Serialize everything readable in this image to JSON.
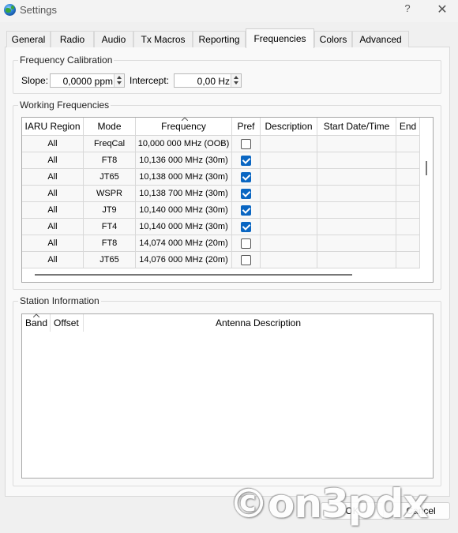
{
  "window": {
    "title": "Settings",
    "help_label": "?",
    "close_label": "✕"
  },
  "tabs": [
    {
      "label": "General"
    },
    {
      "label": "Radio"
    },
    {
      "label": "Audio"
    },
    {
      "label": "Tx Macros"
    },
    {
      "label": "Reporting"
    },
    {
      "label": "Frequencies",
      "active": true
    },
    {
      "label": "Colors"
    },
    {
      "label": "Advanced"
    }
  ],
  "calibration": {
    "title": "Frequency Calibration",
    "slope_label": "Slope:",
    "slope_value": "0,0000 ppm",
    "intercept_label": "Intercept:",
    "intercept_value": "0,00 Hz"
  },
  "working": {
    "title": "Working Frequencies",
    "columns": [
      "IARU Region",
      "Mode",
      "Frequency",
      "Pref",
      "Description",
      "Start Date/Time",
      "End"
    ],
    "rows": [
      {
        "region": "All",
        "mode": "FreqCal",
        "frequency": "10,000 000 MHz (OOB)",
        "pref": false
      },
      {
        "region": "All",
        "mode": "FT8",
        "frequency": "10,136 000 MHz (30m)",
        "pref": true
      },
      {
        "region": "All",
        "mode": "JT65",
        "frequency": "10,138 000 MHz (30m)",
        "pref": true
      },
      {
        "region": "All",
        "mode": "WSPR",
        "frequency": "10,138 700 MHz (30m)",
        "pref": true
      },
      {
        "region": "All",
        "mode": "JT9",
        "frequency": "10,140 000 MHz (30m)",
        "pref": true
      },
      {
        "region": "All",
        "mode": "FT4",
        "frequency": "10,140 000 MHz (30m)",
        "pref": true
      },
      {
        "region": "All",
        "mode": "FT8",
        "frequency": "14,074 000 MHz (20m)",
        "pref": false
      },
      {
        "region": "All",
        "mode": "JT65",
        "frequency": "14,076 000 MHz (20m)",
        "pref": false
      }
    ]
  },
  "station": {
    "title": "Station Information",
    "columns": [
      "Band",
      "Offset",
      "Antenna Description"
    ]
  },
  "buttons": {
    "ok": "OK",
    "cancel": "Cancel"
  },
  "watermark": "©on3pdx",
  "colors": {
    "checkbox_checked": "#0a66c2",
    "pane_background": "#f9f9f9"
  }
}
